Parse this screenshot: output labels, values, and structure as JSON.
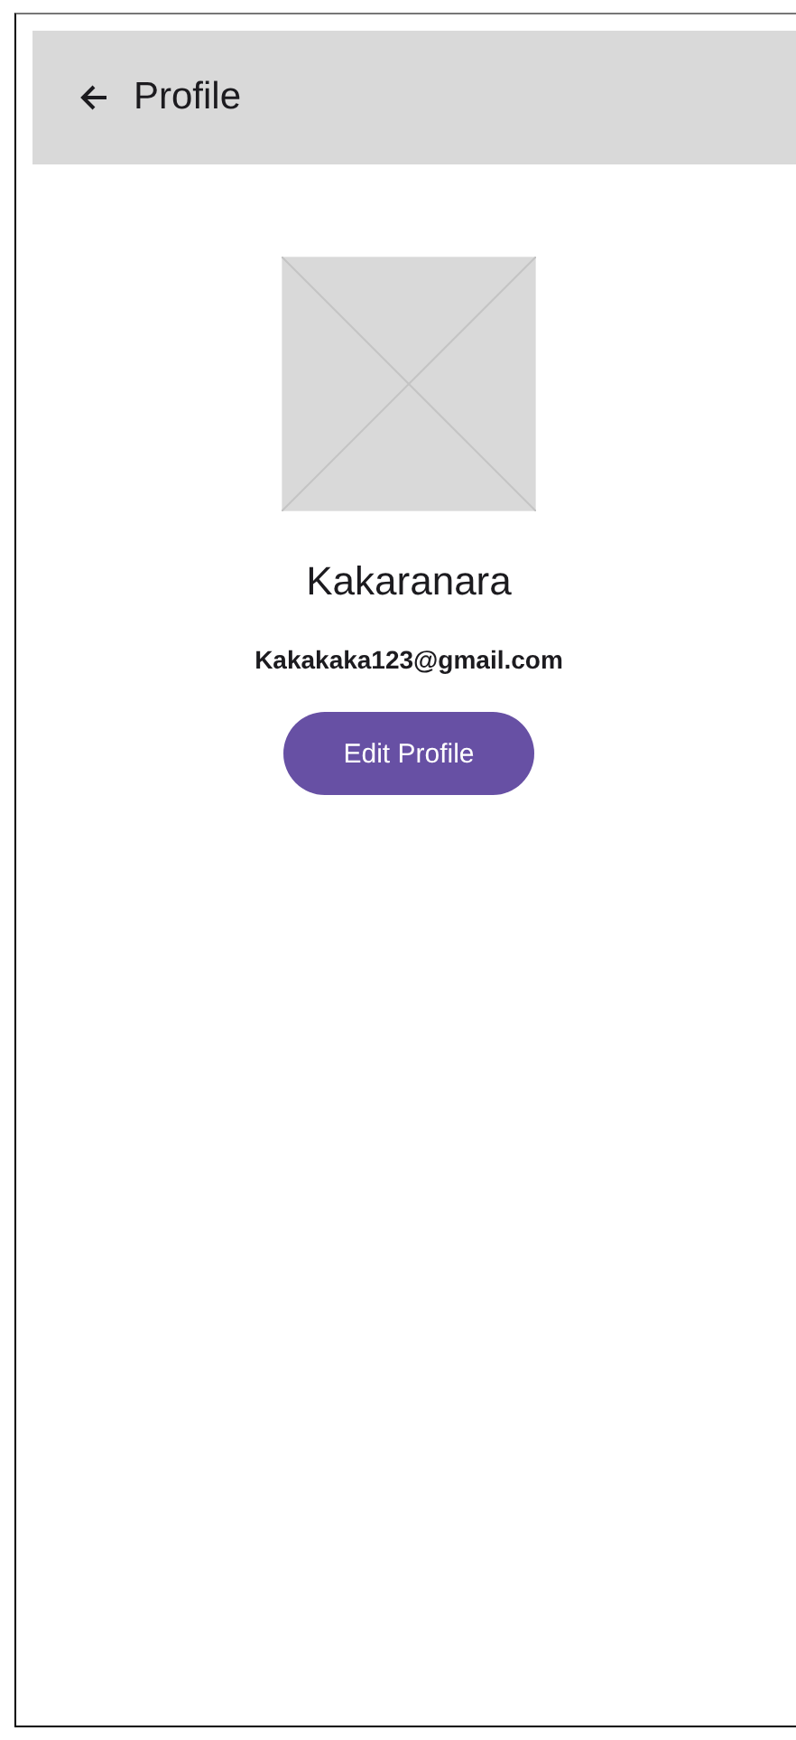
{
  "app_bar": {
    "title": "Profile"
  },
  "profile": {
    "name": "Kakaranara",
    "email": "Kakakaka123@gmail.com",
    "avatar": {
      "kind": "placeholder"
    }
  },
  "buttons": [
    {
      "label": "Edit Profile"
    }
  ]
}
